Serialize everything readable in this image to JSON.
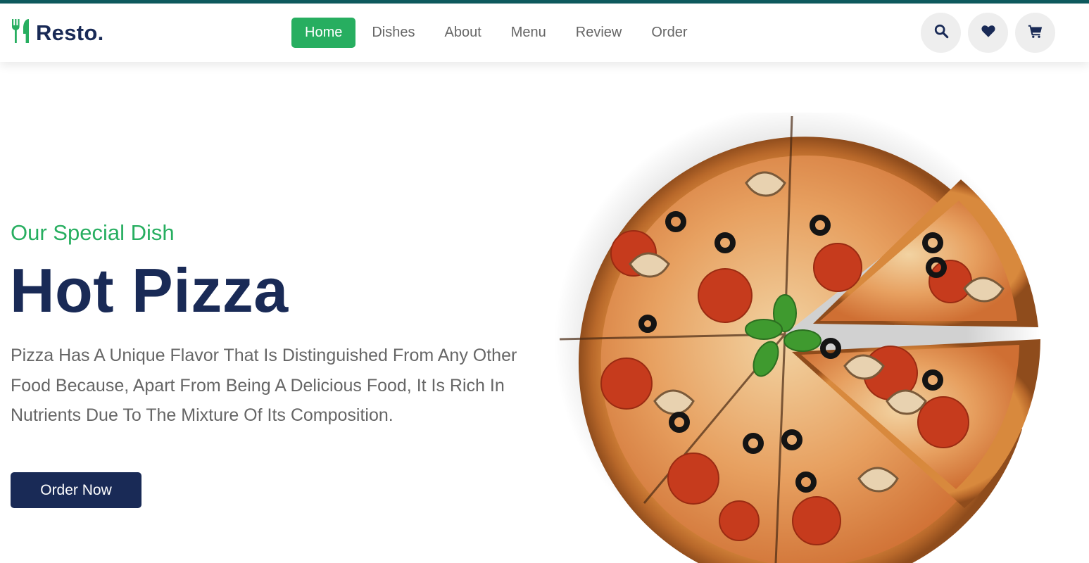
{
  "brand": {
    "name": "Resto.",
    "logo_icon": "utensils-icon"
  },
  "nav": {
    "items": [
      {
        "label": "Home",
        "active": true
      },
      {
        "label": "Dishes",
        "active": false
      },
      {
        "label": "About",
        "active": false
      },
      {
        "label": "Menu",
        "active": false
      },
      {
        "label": "Review",
        "active": false
      },
      {
        "label": "Order",
        "active": false
      }
    ]
  },
  "header_icons": [
    "search-icon",
    "heart-icon",
    "cart-icon"
  ],
  "hero": {
    "subtitle": "Our Special Dish",
    "title": "Hot Pizza",
    "description": "Pizza Has A Unique Flavor That Is Distinguished From Any Other Food Because, Apart From Being A Delicious Food, It Is Rich In Nutrients Due To The Mixture Of Its Composition.",
    "cta_label": "Order Now",
    "image": "pizza-image"
  },
  "colors": {
    "accent": "#27ae60",
    "navy": "#192a56",
    "text_gray": "#666666",
    "icon_bg": "#eeeeee",
    "top_bar": "#0f5a5e"
  }
}
